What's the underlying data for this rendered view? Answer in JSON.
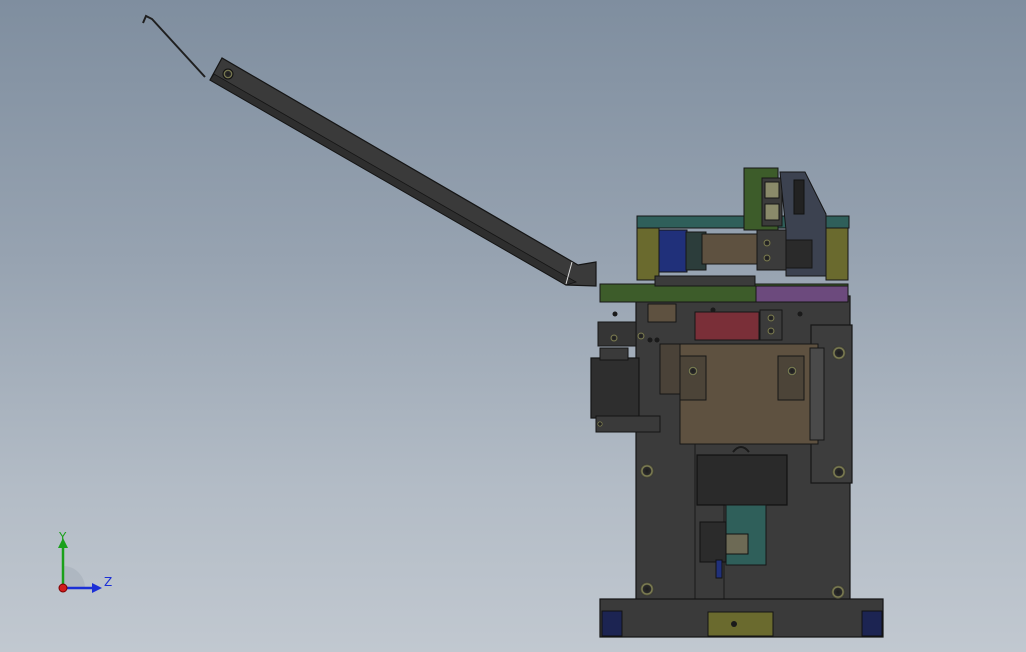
{
  "viewport": {
    "background_top": "#7f8e9f",
    "background_bottom": "#c1c8d0"
  },
  "triad": {
    "x_axis_label": "Z",
    "y_axis_label": "Y",
    "colors": {
      "y": "#1aa01a",
      "z": "#1b2fd6",
      "origin": "#d01c1c"
    }
  },
  "part_colors": {
    "body": "#3b3b3b",
    "plate_olive": "#6a6a2e",
    "plate_green": "#3d5c2a",
    "block_brown": "#5e5140",
    "block_red": "#7a2f38",
    "slider_purple": "#6c4a7d",
    "teal": "#2f5f5a",
    "blue": "#20307a",
    "navy_foot": "#1c2452"
  }
}
